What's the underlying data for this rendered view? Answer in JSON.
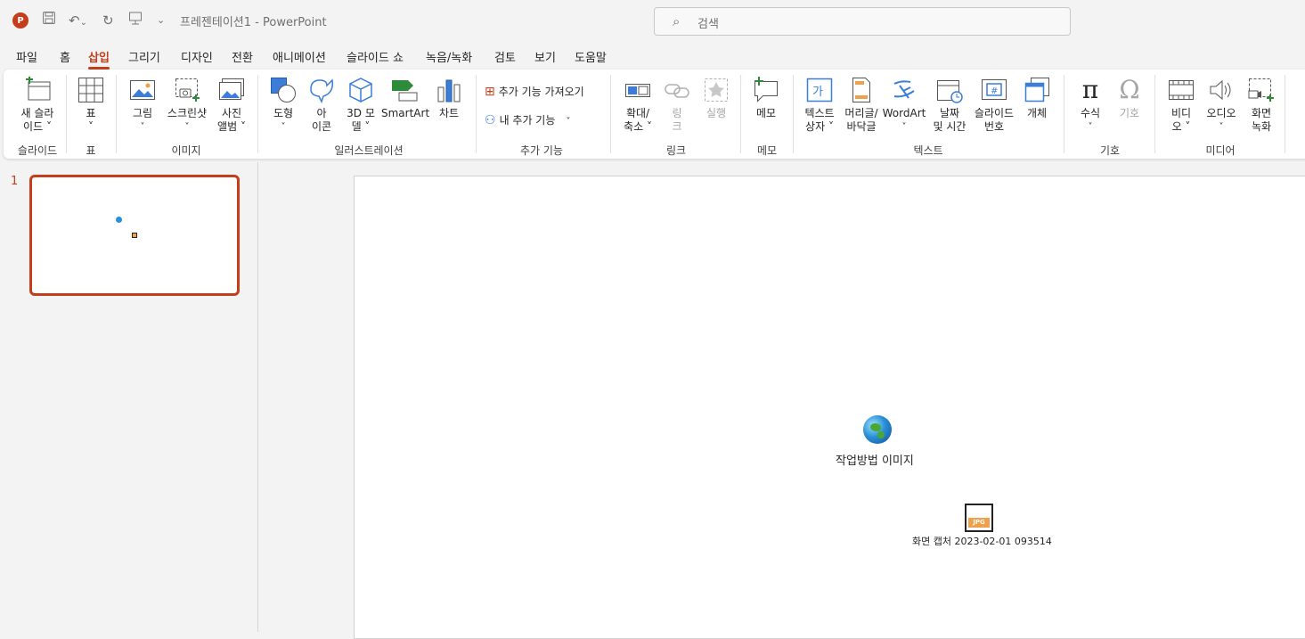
{
  "titlebar": {
    "app_logo": "P",
    "doc_title": "프레젠테이션1  -  PowerPoint",
    "search_placeholder": "검색"
  },
  "tabs": [
    {
      "label": "파일"
    },
    {
      "label": "홈"
    },
    {
      "label": "삽입",
      "active": true
    },
    {
      "label": "그리기"
    },
    {
      "label": "디자인"
    },
    {
      "label": "전환"
    },
    {
      "label": "애니메이션"
    },
    {
      "label": "슬라이드 쇼"
    },
    {
      "label": "녹음/녹화"
    },
    {
      "label": "검토"
    },
    {
      "label": "보기"
    },
    {
      "label": "도움말"
    }
  ],
  "ribbon": {
    "slides": {
      "new_slide_1": "새 슬라",
      "new_slide_2": "이드 ˅",
      "group": "슬라이드"
    },
    "table": {
      "label": "표",
      "arrow": "˅",
      "group": "표"
    },
    "images": {
      "picture": "그림",
      "screenshot": "스크린샷",
      "album_1": "사진",
      "album_2": "앨범 ˅",
      "group": "이미지"
    },
    "illustrations": {
      "shapes": "도형",
      "icons_1": "아",
      "icons_2": "이콘",
      "model_1": "3D 모",
      "model_2": "델 ˅",
      "smartart": "SmartArt",
      "chart": "차트",
      "group": "일러스트레이션"
    },
    "addins": {
      "get": "추가 기능 가져오기",
      "mine": "내 추가 기능",
      "group": "추가 기능"
    },
    "links": {
      "zoom_1": "확대/",
      "zoom_2": "축소 ˅",
      "link_1": "링",
      "link_2": "크",
      "action": "실행",
      "group": "링크"
    },
    "comments": {
      "comment": "메모",
      "group": "메모"
    },
    "text": {
      "textbox_1": "텍스트",
      "textbox_2": "상자 ˅",
      "header_1": "머리글/",
      "header_2": "바닥글",
      "wordart": "WordArt",
      "date_1": "날짜",
      "date_2": "및 시간",
      "slidenum_1": "슬라이드",
      "slidenum_2": "번호",
      "object": "개체",
      "group": "텍스트"
    },
    "symbols": {
      "equation": "수식",
      "symbol": "기호",
      "group": "기호"
    },
    "media": {
      "video_1": "비디",
      "video_2": "오 ˅",
      "audio": "오디오",
      "record_1": "화면",
      "record_2": "녹화",
      "group": "미디어"
    }
  },
  "thumbnails": {
    "slide_number": "1"
  },
  "slide": {
    "object1_label": "작업방법 이미지",
    "object2_label": "화면 캡처 2023-02-01 093514",
    "object2_badge": "JPG"
  },
  "colors": {
    "accent": "#c43e1c"
  },
  "icons": [
    "save-icon",
    "undo-icon",
    "redo-icon",
    "presenter-icon",
    "customize-icon",
    "search-icon",
    "globe-icon",
    "jpg-file-icon"
  ]
}
